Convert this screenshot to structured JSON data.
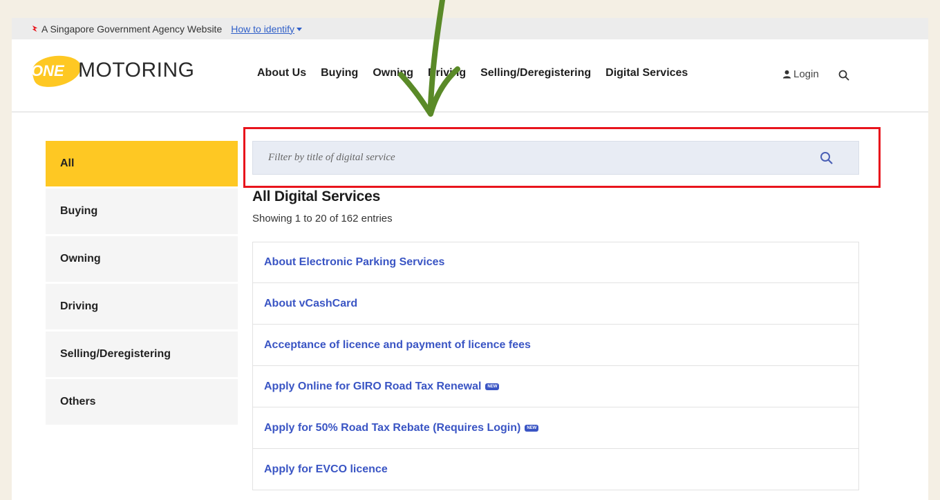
{
  "masthead": {
    "text": "A Singapore Government Agency Website",
    "link": "How to identify"
  },
  "logo": {
    "one": "ONE",
    "motoring": "MOTORING"
  },
  "nav": [
    "About Us",
    "Buying",
    "Owning",
    "Driving",
    "Selling/Deregistering",
    "Digital Services"
  ],
  "header": {
    "login": "Login"
  },
  "sidebar": {
    "items": [
      "All",
      "Buying",
      "Owning",
      "Driving",
      "Selling/Deregistering",
      "Others"
    ],
    "active_index": 0
  },
  "search": {
    "placeholder": "Filter by title of digital service",
    "value": ""
  },
  "main": {
    "title": "All Digital Services",
    "entries": "Showing 1 to 20 of 162 entries",
    "items": [
      {
        "label": "About Electronic Parking Services",
        "badge": ""
      },
      {
        "label": "About vCashCard",
        "badge": ""
      },
      {
        "label": "Acceptance of licence and payment of licence fees",
        "badge": ""
      },
      {
        "label": "Apply Online for GIRO Road Tax Renewal",
        "badge": "NEW"
      },
      {
        "label": "Apply for 50% Road Tax Rebate (Requires Login)",
        "badge": "NEW"
      },
      {
        "label": "Apply for EVCO licence",
        "badge": ""
      }
    ]
  },
  "colors": {
    "accent_yellow": "#fec823",
    "link_blue": "#3a55c4",
    "highlight_red": "#e8141c",
    "annotation_green": "#5a8a28"
  }
}
